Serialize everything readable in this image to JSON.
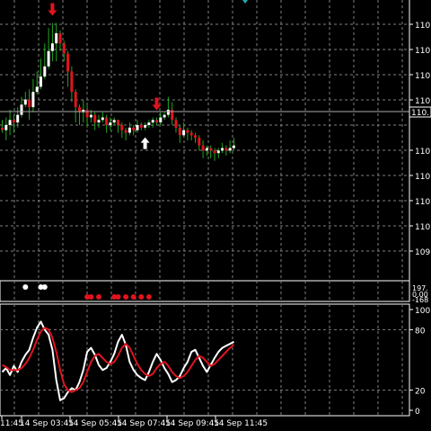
{
  "colors": {
    "background": "#000000",
    "grid": "#7f7f7f",
    "axis": "#ffffff",
    "bull_candle": "#ffffff",
    "bear_candle": "#e0141e",
    "wick_green": "#1fa81f",
    "arrow_down": "#e0141e",
    "arrow_up": "#ffffff",
    "stoch_main": "#ffffff",
    "stoch_signal": "#e0141e"
  },
  "price_axis": {
    "labels": [
      "110.",
      "110.",
      "110.",
      "110.",
      "110.",
      "110.",
      "110.",
      "110.",
      "109."
    ],
    "current_price_label": "110."
  },
  "time_axis": {
    "labels": [
      "11:45",
      "14 Sep 03:45",
      "14 Sep 05:45",
      "14 Sep 07:45",
      "14 Sep 09:45",
      "14 Sep 11:45"
    ]
  },
  "indicator1": {
    "labels": [
      "197.",
      "0.00",
      "-168"
    ]
  },
  "indicator2": {
    "labels": [
      "100",
      "80",
      "20",
      "0"
    ]
  },
  "chart_data": [
    {
      "type": "candlestick",
      "title": "",
      "candles": [
        [
          60,
          59,
          63,
          58
        ],
        [
          59,
          61,
          64,
          55
        ],
        [
          61,
          63,
          67,
          57
        ],
        [
          63,
          62,
          65,
          58
        ],
        [
          62,
          65,
          68,
          60
        ],
        [
          65,
          69,
          72,
          64
        ],
        [
          69,
          71,
          74,
          68
        ],
        [
          71,
          68,
          75,
          63
        ],
        [
          68,
          74,
          79,
          66
        ],
        [
          74,
          76,
          82,
          73
        ],
        [
          76,
          80,
          87,
          75
        ],
        [
          80,
          84,
          93,
          79
        ],
        [
          84,
          90,
          99,
          83
        ],
        [
          90,
          93,
          101,
          86
        ],
        [
          93,
          97,
          101,
          86
        ],
        [
          97,
          93,
          98,
          90
        ],
        [
          93,
          89,
          94,
          86
        ],
        [
          89,
          82,
          90,
          76
        ],
        [
          82,
          74,
          84,
          70
        ],
        [
          74,
          68,
          75,
          62
        ],
        [
          68,
          66,
          69,
          61
        ],
        [
          66,
          67,
          71,
          62
        ],
        [
          67,
          64,
          69,
          60
        ],
        [
          64,
          65,
          67,
          62
        ],
        [
          65,
          62,
          66,
          59
        ],
        [
          62,
          63,
          65,
          60
        ],
        [
          63,
          64,
          66,
          62
        ],
        [
          64,
          61,
          65,
          58
        ],
        [
          61,
          62,
          64,
          59
        ],
        [
          62,
          63,
          64,
          61
        ],
        [
          63,
          61,
          63,
          58
        ],
        [
          61,
          59,
          62,
          56
        ],
        [
          59,
          58,
          60,
          55
        ],
        [
          58,
          60,
          62,
          57
        ],
        [
          60,
          59,
          61,
          57
        ],
        [
          59,
          61,
          63,
          58
        ],
        [
          61,
          60,
          62,
          59
        ],
        [
          60,
          61,
          62,
          59
        ],
        [
          61,
          62,
          63,
          60
        ],
        [
          62,
          63,
          64,
          60
        ],
        [
          63,
          62,
          64,
          61
        ],
        [
          62,
          64,
          66,
          61
        ],
        [
          64,
          65,
          66,
          63
        ],
        [
          65,
          67,
          72,
          64
        ],
        [
          67,
          63,
          70,
          61
        ],
        [
          63,
          60,
          64,
          58
        ],
        [
          60,
          57,
          61,
          54
        ],
        [
          57,
          59,
          62,
          56
        ],
        [
          59,
          58,
          60,
          55
        ],
        [
          58,
          57,
          59,
          55
        ],
        [
          57,
          56,
          58,
          54
        ],
        [
          56,
          53,
          57,
          51
        ],
        [
          53,
          51,
          55,
          48
        ],
        [
          51,
          52,
          53,
          49
        ],
        [
          52,
          51,
          53,
          48
        ],
        [
          51,
          50,
          52,
          47
        ],
        [
          50,
          51,
          52,
          48
        ],
        [
          51,
          52,
          54,
          50
        ],
        [
          52,
          51,
          53,
          49
        ],
        [
          51,
          52,
          55,
          50
        ],
        [
          52,
          53,
          56,
          51
        ]
      ],
      "signals_down": [
        13,
        40
      ],
      "signals_up": [
        37
      ],
      "ylim": [
        0,
        110
      ]
    },
    {
      "type": "dots",
      "title": "",
      "white_dots": [
        6,
        10,
        11
      ],
      "red_dots": [
        22,
        23,
        25,
        29,
        30,
        32,
        34,
        36,
        38
      ]
    },
    {
      "type": "line",
      "title": "",
      "ylim": [
        0,
        100
      ],
      "series": [
        {
          "values": [
            38,
            42,
            35,
            44,
            38,
            48,
            55,
            60,
            72,
            82,
            88,
            80,
            75,
            60,
            30,
            10,
            12,
            18,
            22,
            20,
            28,
            40,
            58,
            62,
            55,
            45,
            40,
            42,
            48,
            56,
            68,
            75,
            65,
            48,
            40,
            35,
            32,
            30,
            38,
            48,
            56,
            50,
            42,
            36,
            28,
            30,
            34,
            42,
            48,
            58,
            60,
            52,
            44,
            38,
            45,
            52,
            58,
            62,
            64,
            66,
            68
          ]
        },
        {
          "values": [
            45,
            43,
            40,
            40,
            40,
            42,
            46,
            52,
            60,
            70,
            78,
            82,
            80,
            72,
            58,
            40,
            26,
            20,
            18,
            20,
            22,
            28,
            38,
            48,
            54,
            56,
            52,
            48,
            46,
            48,
            54,
            62,
            66,
            62,
            54,
            46,
            40,
            36,
            34,
            36,
            42,
            46,
            48,
            44,
            38,
            34,
            32,
            34,
            38,
            44,
            50,
            54,
            52,
            48,
            44,
            46,
            50,
            54,
            58,
            62,
            65
          ]
        }
      ]
    }
  ]
}
